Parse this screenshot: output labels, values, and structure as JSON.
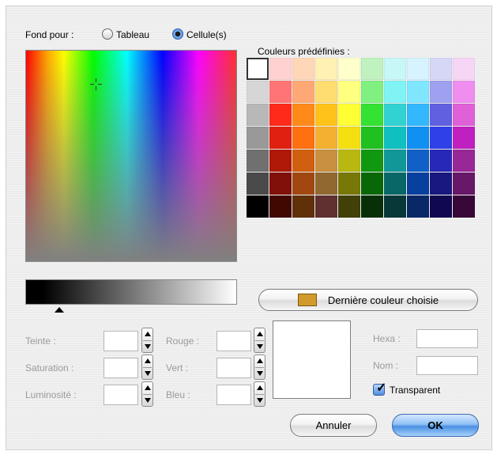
{
  "header": {
    "fond_label": "Fond pour :",
    "option_tableau": "Tableau",
    "option_cellules": "Cellule(s)",
    "selected": "Cellule(s)"
  },
  "palette": {
    "title": "Couleurs prédéfinies :",
    "rows": [
      [
        "#ffffff",
        "#ffd1d1",
        "#ffd7b8",
        "#fff0b3",
        "#ffffcc",
        "#bff2bf",
        "#c8f7f7",
        "#d6f3ff",
        "#d6d6f7",
        "#f7d6f5"
      ],
      [
        "#d6d6d6",
        "#ff7575",
        "#ffa875",
        "#ffdd70",
        "#ffff80",
        "#80f080",
        "#80f4f4",
        "#80e6ff",
        "#a0a0f0",
        "#f08ef0"
      ],
      [
        "#b8b8b8",
        "#ff2a1a",
        "#ff8a1a",
        "#ffc21a",
        "#ffff33",
        "#33e233",
        "#33d2d2",
        "#33b8ff",
        "#6060e0",
        "#e060d8"
      ],
      [
        "#999999",
        "#e02010",
        "#ff7010",
        "#f4b030",
        "#f4e010",
        "#20c020",
        "#10c0c0",
        "#1090f0",
        "#3040e8",
        "#c020c0"
      ],
      [
        "#707070",
        "#b01808",
        "#d06010",
        "#c89040",
        "#b8b810",
        "#109810",
        "#109898",
        "#1060c8",
        "#2828b8",
        "#982898"
      ],
      [
        "#4a4a4a",
        "#801008",
        "#a04810",
        "#906830",
        "#787808",
        "#086808",
        "#086868",
        "#0840a0",
        "#181880",
        "#681868"
      ],
      [
        "#000000",
        "#400800",
        "#603008",
        "#603030",
        "#404008",
        "#083008",
        "#083838",
        "#082868",
        "#100850",
        "#380838"
      ]
    ],
    "selected_index": [
      0,
      0
    ]
  },
  "last_color": {
    "label": "Dernière couleur choisie",
    "swatch": "#d19a2a"
  },
  "fields": {
    "teinte": {
      "label": "Teinte :",
      "value": ""
    },
    "saturation": {
      "label": "Saturation :",
      "value": ""
    },
    "luminosite": {
      "label": "Luminosité :",
      "value": ""
    },
    "rouge": {
      "label": "Rouge :",
      "value": ""
    },
    "vert": {
      "label": "Vert :",
      "value": ""
    },
    "bleu": {
      "label": "Bleu :",
      "value": ""
    },
    "hexa": {
      "label": "Hexa :",
      "value": ""
    },
    "nom": {
      "label": "Nom :",
      "value": ""
    }
  },
  "transparent": {
    "label": "Transparent",
    "checked": true
  },
  "buttons": {
    "cancel": "Annuler",
    "ok": "OK"
  },
  "colors": {
    "accent": "#3c7fd5",
    "disabled_text": "#9a9a9a"
  }
}
